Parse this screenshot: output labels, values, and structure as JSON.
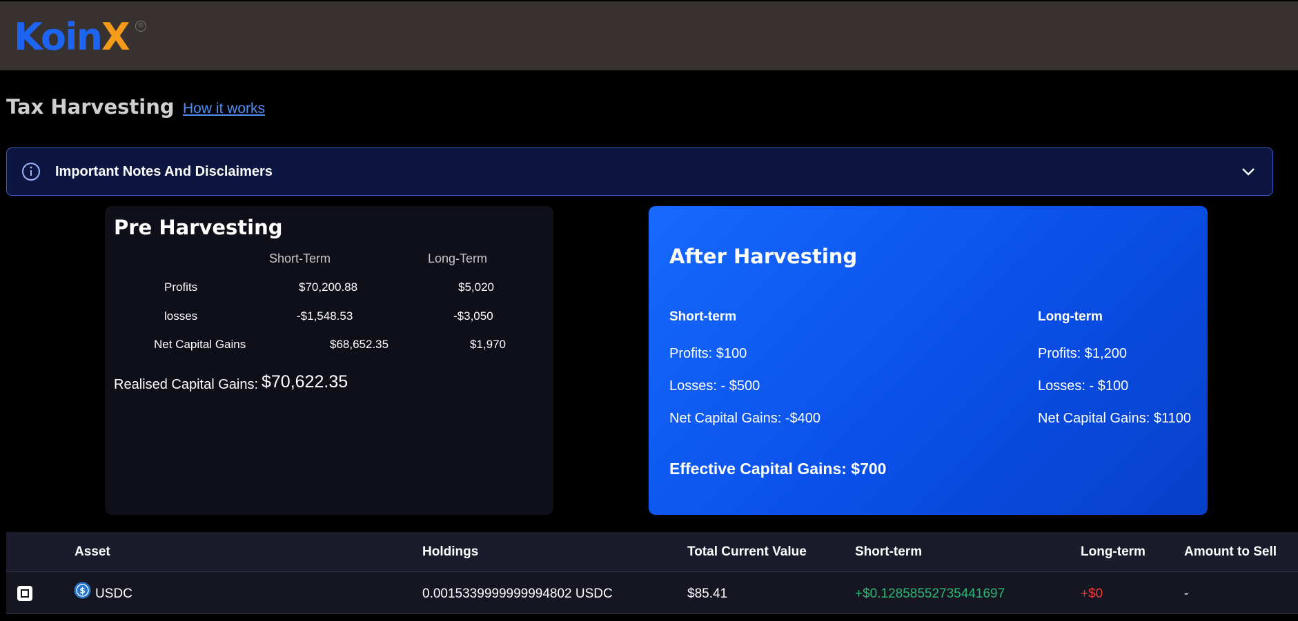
{
  "header": {
    "logo": {
      "text_main": "Koin",
      "text_accent": "X",
      "reg_mark": "®"
    }
  },
  "page": {
    "title": "Tax Harvesting",
    "how_it_works": "How it works"
  },
  "notes": {
    "label": "Important Notes And Disclaimers",
    "icon": "info-icon",
    "toggle_icon": "chevron-down-icon"
  },
  "pre_harvesting": {
    "title": "Pre Harvesting",
    "headers": {
      "short": "Short-Term",
      "long": "Long-Term"
    },
    "rows": [
      {
        "label": "Profits",
        "short": "$70,200.88",
        "long": "$5,020"
      },
      {
        "label": "losses",
        "short": "-$1,548.53",
        "long": "-$3,050"
      },
      {
        "label": "Net Capital Gains",
        "short": "$68,652.35",
        "long": "$1,970"
      }
    ],
    "realised_label": "Realised Capital Gains:",
    "realised_value": "$70,622.35"
  },
  "after_harvesting": {
    "title": "After Harvesting",
    "short_term": {
      "heading": "Short-term",
      "profits": "Profits: $100",
      "losses": "Losses: - $500",
      "net": "Net Capital Gains: -$400"
    },
    "long_term": {
      "heading": "Long-term",
      "profits": "Profits: $1,200",
      "losses": "Losses: - $100",
      "net": "Net Capital Gains: $1100"
    },
    "effective": "Effective Capital Gains: $700"
  },
  "table": {
    "columns": [
      "Asset",
      "Holdings",
      "Total Current Value",
      "Short-term",
      "Long-term",
      "Amount to Sell"
    ],
    "rows": [
      {
        "asset": "USDC",
        "holdings": "0.0015339999999994802 USDC",
        "value": "$85.41",
        "short": "+$0.12858552735441697",
        "long": "+$0",
        "amount": "-"
      }
    ]
  },
  "colors": {
    "accent_blue": "#1669ff",
    "logo_orange": "#f59b1c",
    "positive": "#2bb673",
    "negative": "#ef3b3b"
  }
}
